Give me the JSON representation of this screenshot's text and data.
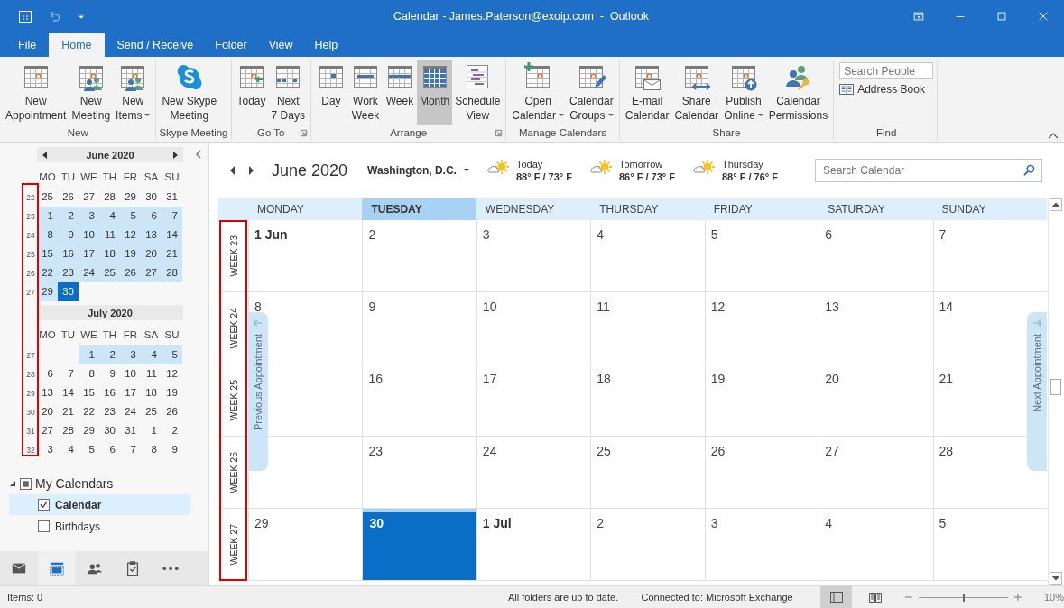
{
  "window": {
    "title": "Calendar - James.Paterson@exoip.com  -  Outlook"
  },
  "ribbon": {
    "tabs": [
      {
        "label": "File",
        "selected": false
      },
      {
        "label": "Home",
        "selected": true
      },
      {
        "label": "Send / Receive",
        "selected": false
      },
      {
        "label": "Folder",
        "selected": false
      },
      {
        "label": "View",
        "selected": false
      },
      {
        "label": "Help",
        "selected": false
      }
    ],
    "groups": [
      {
        "kind": "buttons",
        "label": "New",
        "items": [
          {
            "kind": "appointment",
            "lines": [
              "New",
              "Appointment"
            ]
          },
          {
            "kind": "meeting",
            "lines": [
              "New",
              "Meeting"
            ]
          },
          {
            "kind": "items",
            "lines": [
              "New",
              "Items"
            ],
            "dropdown": true
          }
        ]
      },
      {
        "kind": "buttons",
        "label": "Skype Meeting",
        "items": [
          {
            "kind": "skype",
            "lines": [
              "New Skype",
              "Meeting"
            ]
          }
        ]
      },
      {
        "kind": "buttons",
        "label": "Go To",
        "launcher": true,
        "items": [
          {
            "kind": "today",
            "lines": [
              "Today"
            ]
          },
          {
            "kind": "next7",
            "lines": [
              "Next",
              "7 Days"
            ]
          }
        ]
      },
      {
        "kind": "buttons",
        "label": "Arrange",
        "launcher": true,
        "items": [
          {
            "kind": "day",
            "lines": [
              "Day"
            ],
            "selected": false
          },
          {
            "kind": "workweek",
            "lines": [
              "Work",
              "Week"
            ],
            "selected": false
          },
          {
            "kind": "week",
            "lines": [
              "Week"
            ],
            "selected": false
          },
          {
            "kind": "month",
            "lines": [
              "Month"
            ],
            "selected": true
          },
          {
            "kind": "schedule",
            "lines": [
              "Schedule",
              "View"
            ],
            "selected": false
          }
        ]
      },
      {
        "kind": "buttons",
        "label": "Manage Calendars",
        "items": [
          {
            "kind": "open",
            "lines": [
              "Open",
              "Calendar"
            ],
            "dropdown": true
          },
          {
            "kind": "groups",
            "lines": [
              "Calendar",
              "Groups"
            ],
            "dropdown": true
          }
        ]
      },
      {
        "kind": "buttons",
        "label": "Share",
        "items": [
          {
            "kind": "email",
            "lines": [
              "E-mail",
              "Calendar"
            ]
          },
          {
            "kind": "share",
            "lines": [
              "Share",
              "Calendar"
            ]
          },
          {
            "kind": "publish",
            "lines": [
              "Publish",
              "Online"
            ],
            "dropdown": true
          },
          {
            "kind": "permissions",
            "lines": [
              "Calendar",
              "Permissions"
            ]
          }
        ]
      },
      {
        "kind": "find",
        "label": "Find",
        "search": {
          "placeholder": "Search People"
        },
        "link": "Address Book"
      }
    ]
  },
  "mini_calendars": [
    {
      "title": "June 2020",
      "nav_arrows": true,
      "weekdays": [
        "MO",
        "TU",
        "WE",
        "TH",
        "FR",
        "SA",
        "SU"
      ],
      "weeks": [
        {
          "number": "22",
          "days": [
            {
              "kind": "day",
              "day": "25",
              "in_view": false,
              "selected": false
            },
            {
              "kind": "day",
              "day": "26",
              "in_view": false,
              "selected": false
            },
            {
              "kind": "day",
              "day": "27",
              "in_view": false,
              "selected": false
            },
            {
              "kind": "day",
              "day": "28",
              "in_view": false,
              "selected": false
            },
            {
              "kind": "day",
              "day": "29",
              "in_view": false,
              "selected": false
            },
            {
              "kind": "day",
              "day": "30",
              "in_view": false,
              "selected": false
            },
            {
              "kind": "day",
              "day": "31",
              "in_view": false,
              "selected": false
            }
          ]
        },
        {
          "number": "23",
          "days": [
            {
              "kind": "day",
              "day": "1",
              "in_view": true,
              "selected": false
            },
            {
              "kind": "day",
              "day": "2",
              "in_view": true,
              "selected": false
            },
            {
              "kind": "day",
              "day": "3",
              "in_view": true,
              "selected": false
            },
            {
              "kind": "day",
              "day": "4",
              "in_view": true,
              "selected": false
            },
            {
              "kind": "day",
              "day": "5",
              "in_view": true,
              "selected": false
            },
            {
              "kind": "day",
              "day": "6",
              "in_view": true,
              "selected": false
            },
            {
              "kind": "day",
              "day": "7",
              "in_view": true,
              "selected": false
            }
          ]
        },
        {
          "number": "24",
          "days": [
            {
              "kind": "day",
              "day": "8",
              "in_view": true,
              "selected": false
            },
            {
              "kind": "day",
              "day": "9",
              "in_view": true,
              "selected": false
            },
            {
              "kind": "day",
              "day": "10",
              "in_view": true,
              "selected": false
            },
            {
              "kind": "day",
              "day": "11",
              "in_view": true,
              "selected": false
            },
            {
              "kind": "day",
              "day": "12",
              "in_view": true,
              "selected": false
            },
            {
              "kind": "day",
              "day": "13",
              "in_view": true,
              "selected": false
            },
            {
              "kind": "day",
              "day": "14",
              "in_view": true,
              "selected": false
            }
          ]
        },
        {
          "number": "25",
          "days": [
            {
              "kind": "day",
              "day": "15",
              "in_view": true,
              "selected": false
            },
            {
              "kind": "day",
              "day": "16",
              "in_view": true,
              "selected": false
            },
            {
              "kind": "day",
              "day": "17",
              "in_view": true,
              "selected": false
            },
            {
              "kind": "day",
              "day": "18",
              "in_view": true,
              "selected": false
            },
            {
              "kind": "day",
              "day": "19",
              "in_view": true,
              "selected": false
            },
            {
              "kind": "day",
              "day": "20",
              "in_view": true,
              "selected": false
            },
            {
              "kind": "day",
              "day": "21",
              "in_view": true,
              "selected": false
            }
          ]
        },
        {
          "number": "26",
          "days": [
            {
              "kind": "day",
              "day": "22",
              "in_view": true,
              "selected": false
            },
            {
              "kind": "day",
              "day": "23",
              "in_view": true,
              "selected": false
            },
            {
              "kind": "day",
              "day": "24",
              "in_view": true,
              "selected": false
            },
            {
              "kind": "day",
              "day": "25",
              "in_view": true,
              "selected": false
            },
            {
              "kind": "day",
              "day": "26",
              "in_view": true,
              "selected": false
            },
            {
              "kind": "day",
              "day": "27",
              "in_view": true,
              "selected": false
            },
            {
              "kind": "day",
              "day": "28",
              "in_view": true,
              "selected": false
            }
          ]
        },
        {
          "number": "27",
          "days": [
            {
              "kind": "day",
              "day": "29",
              "in_view": true,
              "selected": false
            },
            {
              "kind": "day",
              "day": "30",
              "in_view": true,
              "selected": true
            }
          ]
        }
      ]
    },
    {
      "title": "July 2020",
      "weekdays": [
        "MO",
        "TU",
        "WE",
        "TH",
        "FR",
        "SA",
        "SU"
      ],
      "weeks": [
        {
          "number": "27",
          "days": [
            {
              "kind": "blank"
            },
            {
              "kind": "blank"
            },
            {
              "kind": "day",
              "day": "1",
              "in_view": true,
              "selected": false
            },
            {
              "kind": "day",
              "day": "2",
              "in_view": true,
              "selected": false
            },
            {
              "kind": "day",
              "day": "3",
              "in_view": true,
              "selected": false
            },
            {
              "kind": "day",
              "day": "4",
              "in_view": true,
              "selected": false
            },
            {
              "kind": "day",
              "day": "5",
              "in_view": true,
              "selected": false
            }
          ]
        },
        {
          "number": "28",
          "days": [
            {
              "kind": "day",
              "day": "6",
              "in_view": false,
              "selected": false
            },
            {
              "kind": "day",
              "day": "7",
              "in_view": false,
              "selected": false
            },
            {
              "kind": "day",
              "day": "8",
              "in_view": false,
              "selected": false
            },
            {
              "kind": "day",
              "day": "9",
              "in_view": false,
              "selected": false
            },
            {
              "kind": "day",
              "day": "10",
              "in_view": false,
              "selected": false
            },
            {
              "kind": "day",
              "day": "11",
              "in_view": false,
              "selected": false
            },
            {
              "kind": "day",
              "day": "12",
              "in_view": false,
              "selected": false
            }
          ]
        },
        {
          "number": "29",
          "days": [
            {
              "kind": "day",
              "day": "13",
              "in_view": false,
              "selected": false
            },
            {
              "kind": "day",
              "day": "14",
              "in_view": false,
              "selected": false
            },
            {
              "kind": "day",
              "day": "15",
              "in_view": false,
              "selected": false
            },
            {
              "kind": "day",
              "day": "16",
              "in_view": false,
              "selected": false
            },
            {
              "kind": "day",
              "day": "17",
              "in_view": false,
              "selected": false
            },
            {
              "kind": "day",
              "day": "18",
              "in_view": false,
              "selected": false
            },
            {
              "kind": "day",
              "day": "19",
              "in_view": false,
              "selected": false
            }
          ]
        },
        {
          "number": "30",
          "days": [
            {
              "kind": "day",
              "day": "20",
              "in_view": false,
              "selected": false
            },
            {
              "kind": "day",
              "day": "21",
              "in_view": false,
              "selected": false
            },
            {
              "kind": "day",
              "day": "22",
              "in_view": false,
              "selected": false
            },
            {
              "kind": "day",
              "day": "23",
              "in_view": false,
              "selected": false
            },
            {
              "kind": "day",
              "day": "24",
              "in_view": false,
              "selected": false
            },
            {
              "kind": "day",
              "day": "25",
              "in_view": false,
              "selected": false
            },
            {
              "kind": "day",
              "day": "26",
              "in_view": false,
              "selected": false
            }
          ]
        },
        {
          "number": "31",
          "days": [
            {
              "kind": "day",
              "day": "27",
              "in_view": false,
              "selected": false
            },
            {
              "kind": "day",
              "day": "28",
              "in_view": false,
              "selected": false
            },
            {
              "kind": "day",
              "day": "29",
              "in_view": false,
              "selected": false
            },
            {
              "kind": "day",
              "day": "30",
              "in_view": false,
              "selected": false
            },
            {
              "kind": "day",
              "day": "31",
              "in_view": false,
              "selected": false
            },
            {
              "kind": "day",
              "day": "1",
              "in_view": false,
              "selected": false
            },
            {
              "kind": "day",
              "day": "2",
              "in_view": false,
              "selected": false
            }
          ]
        },
        {
          "number": "32",
          "days": [
            {
              "kind": "day",
              "day": "3",
              "in_view": false,
              "selected": false
            },
            {
              "kind": "day",
              "day": "4",
              "in_view": false,
              "selected": false
            },
            {
              "kind": "day",
              "day": "5",
              "in_view": false,
              "selected": false
            },
            {
              "kind": "day",
              "day": "6",
              "in_view": false,
              "selected": false
            },
            {
              "kind": "day",
              "day": "7",
              "in_view": false,
              "selected": false
            },
            {
              "kind": "day",
              "day": "8",
              "in_view": false,
              "selected": false
            },
            {
              "kind": "day",
              "day": "9",
              "in_view": false,
              "selected": false
            }
          ]
        }
      ]
    }
  ],
  "folders": {
    "group": {
      "label": "My Calendars",
      "expanded": true
    },
    "items": [
      {
        "label": "Calendar",
        "checked": true,
        "selected": true
      },
      {
        "label": "Birthdays",
        "checked": false,
        "selected": false
      }
    ]
  },
  "nav": [
    {
      "kind": "mail",
      "selected": false
    },
    {
      "kind": "calendar",
      "selected": true
    },
    {
      "kind": "people",
      "selected": false
    },
    {
      "kind": "tasks",
      "selected": false
    },
    {
      "kind": "more",
      "selected": false
    }
  ],
  "calendar": {
    "title": "June 2020",
    "location": "Washington, D.C.",
    "weather": [
      {
        "day": "Today",
        "temps": "88° F / 73° F"
      },
      {
        "day": "Tomorrow",
        "temps": "86° F / 73° F"
      },
      {
        "day": "Thursday",
        "temps": "88° F / 76° F"
      }
    ],
    "search": {
      "placeholder": "Search Calendar"
    },
    "day_headers": [
      {
        "label": "MONDAY",
        "selected": false
      },
      {
        "label": "TUESDAY",
        "selected": true
      },
      {
        "label": "WEDNESDAY",
        "selected": false
      },
      {
        "label": "THURSDAY",
        "selected": false
      },
      {
        "label": "FRIDAY",
        "selected": false
      },
      {
        "label": "SATURDAY",
        "selected": false
      },
      {
        "label": "SUNDAY",
        "selected": false
      }
    ],
    "weeks": [
      {
        "label": "WEEK 23",
        "days": [
          {
            "label": "1 Jun",
            "bold": true,
            "selected": false
          },
          {
            "label": "2",
            "bold": false,
            "selected": false
          },
          {
            "label": "3",
            "bold": false,
            "selected": false
          },
          {
            "label": "4",
            "bold": false,
            "selected": false
          },
          {
            "label": "5",
            "bold": false,
            "selected": false
          },
          {
            "label": "6",
            "bold": false,
            "selected": false
          },
          {
            "label": "7",
            "bold": false,
            "selected": false
          }
        ]
      },
      {
        "label": "WEEK 24",
        "days": [
          {
            "label": "8",
            "bold": false,
            "selected": false
          },
          {
            "label": "9",
            "bold": false,
            "selected": false
          },
          {
            "label": "10",
            "bold": false,
            "selected": false
          },
          {
            "label": "11",
            "bold": false,
            "selected": false
          },
          {
            "label": "12",
            "bold": false,
            "selected": false
          },
          {
            "label": "13",
            "bold": false,
            "selected": false
          },
          {
            "label": "14",
            "bold": false,
            "selected": false
          }
        ]
      },
      {
        "label": "WEEK 25",
        "days": [
          {
            "label": "16",
            "bold": false,
            "selected": false
          },
          {
            "label": "17",
            "bold": false,
            "selected": false
          },
          {
            "label": "18",
            "bold": false,
            "selected": false
          },
          {
            "label": "19",
            "bold": false,
            "selected": false
          },
          {
            "label": "20",
            "bold": false,
            "selected": false
          },
          {
            "label": "21",
            "bold": false,
            "selected": false
          }
        ]
      },
      {
        "label": "WEEK 26",
        "days": [
          {
            "label": "23",
            "bold": false,
            "selected": false
          },
          {
            "label": "24",
            "bold": false,
            "selected": false
          },
          {
            "label": "25",
            "bold": false,
            "selected": false
          },
          {
            "label": "26",
            "bold": false,
            "selected": false
          },
          {
            "label": "27",
            "bold": false,
            "selected": false
          },
          {
            "label": "28",
            "bold": false,
            "selected": false
          }
        ]
      },
      {
        "label": "WEEK 27",
        "days": [
          {
            "label": "29",
            "bold": false,
            "selected": false
          },
          {
            "label": "30",
            "bold": true,
            "selected": true
          },
          {
            "label": "1 Jul",
            "bold": true,
            "selected": false
          },
          {
            "label": "2",
            "bold": false,
            "selected": false
          },
          {
            "label": "3",
            "bold": false,
            "selected": false
          },
          {
            "label": "4",
            "bold": false,
            "selected": false
          },
          {
            "label": "5",
            "bold": false,
            "selected": false
          }
        ]
      }
    ],
    "side_tabs": [
      {
        "kind": "previous",
        "label": "Previous Appointment"
      },
      {
        "kind": "next",
        "label": "Next Appointment"
      }
    ]
  },
  "status_bar": {
    "items": "Items: 0",
    "sync": "All folders are up to date.",
    "connection": "Connected to: Microsoft Exchange",
    "views": [
      {
        "kind": "normal",
        "selected": true
      },
      {
        "kind": "reading",
        "selected": false
      }
    ],
    "zoom": {
      "level": 0.5,
      "reading": "10%"
    }
  }
}
